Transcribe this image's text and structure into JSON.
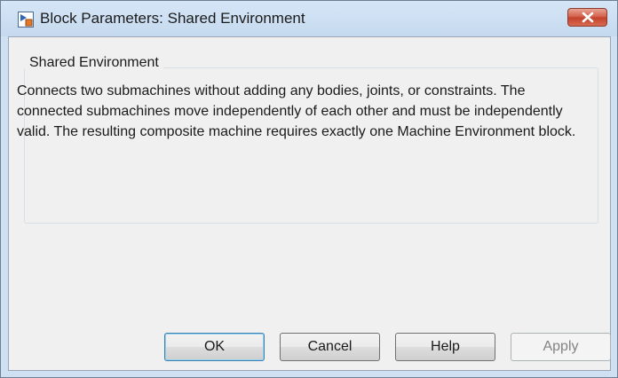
{
  "window": {
    "title": "Block Parameters: Shared Environment",
    "icon": "simulink-block-icon",
    "close_icon": "close-icon",
    "close_color": "#c94a35"
  },
  "group": {
    "legend": "Shared Environment",
    "description": "Connects two submachines without adding any bodies, joints, or constraints. The connected submachines move independently of each other and must be independently valid. The resulting composite machine requires exactly one Machine Environment block."
  },
  "buttons": {
    "ok": "OK",
    "cancel": "Cancel",
    "help": "Help",
    "apply": "Apply"
  }
}
